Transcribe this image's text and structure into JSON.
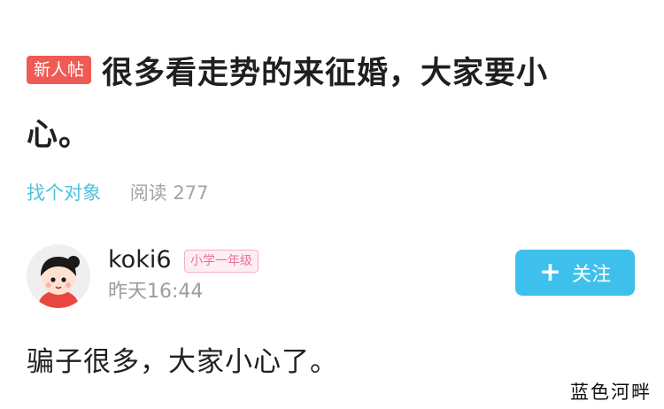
{
  "post": {
    "badge": "新人帖",
    "title_line1": "很多看走势的来征婚，大家要小",
    "title_line2": "心。",
    "category": "找个对象",
    "read_label": "阅读 277"
  },
  "author": {
    "username": "koki6",
    "grade_badge": "小学一年级",
    "time": "昨天16:44"
  },
  "follow_button": {
    "plus": "+",
    "label": "关注"
  },
  "body_text": "骗子很多，大家小心了。",
  "watermark": "蓝色河畔",
  "colors": {
    "new_badge_bg": "#ef5a55",
    "category_link": "#4cc3dc",
    "follow_button_bg": "#3ec0ec",
    "grade_badge_text": "#e9729b"
  }
}
